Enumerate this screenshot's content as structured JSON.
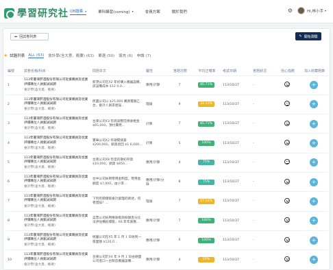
{
  "brand": {
    "name": "學習研究社"
  },
  "nav": {
    "items": [
      {
        "label": "QB題庫",
        "active": true,
        "caret": "▾"
      },
      {
        "label": "單科練習(coming)",
        "active": false,
        "caret": "▾"
      },
      {
        "label": "會員方案",
        "active": false,
        "caret": ""
      },
      {
        "label": "關於我們",
        "active": false,
        "caret": ""
      }
    ]
  },
  "user": {
    "name": "Hi,林小手",
    "caret": "▾"
  },
  "toolbar": {
    "back_label": "回試卷列表",
    "start_label": "開始測驗"
  },
  "filters": {
    "title": "試題列表",
    "tabs": [
      {
        "label": "ALL (63)",
        "active": true
      },
      {
        "label": "會計學(含大意、概要) (63)",
        "active": false
      },
      {
        "label": "單選 (50)",
        "active": false
      },
      {
        "label": "填充 (6)",
        "active": false
      },
      {
        "label": "申論 (7)",
        "active": false
      }
    ]
  },
  "table": {
    "headers": [
      "編號",
      "試卷名稱/科目",
      "問題本文",
      "屬性",
      "答題次數",
      "平均正確率",
      "考試日期",
      "答題狀況",
      "信心指數",
      "加入收藏題庫"
    ],
    "rows": [
      {
        "no": "1",
        "title": "113年臺灣菸酒股份有限公司從業職員及從業評價職位人員甄試試題",
        "subject": "會計學(含大意、概要)",
        "preview": "新港公司在X2 年初購入機器設備，該設備成本 $12 0,0...",
        "attr": "應用/計算",
        "count": "7",
        "rate": "85.71%",
        "rate_color": "#3fb27a",
        "date": "113/10/27",
        "status": "-"
      },
      {
        "no": "2",
        "title": "113年臺灣菸酒股份有限公司從業職員及從業評價職位人員甄試試題",
        "subject": "會計學(含大意、概要)",
        "preview": "民國公司以 $25,000 購買電腦乙台，會計人員李君誤...",
        "attr": "理論",
        "count": "9",
        "rate": "33.33%",
        "rate_color": "#f0b429",
        "date": "113/10/27",
        "status": "-"
      },
      {
        "no": "3",
        "title": "113年臺灣菸酒股份有限公司從業職員及從業評價職位人員甄試試題",
        "subject": "會計學(含大意、概要)",
        "preview": "台東公司X3 年底調整前預收租金 $65,000，預付費用...",
        "attr": "計算",
        "count": "7",
        "rate": "85.71%",
        "rate_color": "#3fb27a",
        "date": "113/10/27",
        "status": "-"
      },
      {
        "no": "4",
        "title": "113年臺灣菸酒股份有限公司從業職員及從業評價職位人員甄試試題",
        "subject": "會計學(含大意、概要)",
        "preview": "寶華公司X2 年期間銷貨 $200,000，銷貨退回 $1 6,000...",
        "attr": "計算",
        "count": "5",
        "rate": "100%",
        "rate_color": "#3fb27a",
        "date": "113/10/27",
        "status": "-"
      },
      {
        "no": "5",
        "title": "113年臺灣菸酒股份有限公司從業職員及從業評價職位人員甄試試題",
        "subject": "會計學(含大意、概要)",
        "preview": "台南公司X8 年度的期初存貨 $10,000，銷貨 $850...",
        "attr": "應用/計算",
        "count": "4",
        "rate": "75%",
        "rate_color": "#45b5a6",
        "date": "113/10/27",
        "status": "-"
      },
      {
        "no": "6",
        "title": "113年臺灣菸酒股份有限公司從業職員及從業評價職位人員甄試試題",
        "subject": "會計學(含大意、概要)",
        "preview": "台中公司採用零用金制度，零用金額度 $7,000，由小李...",
        "attr": "應用/計算/分錄",
        "count": "8",
        "rate": "75%",
        "rate_color": "#45b5a6",
        "date": "113/10/27",
        "status": "-"
      },
      {
        "no": "7",
        "title": "113年臺灣菸酒股份有限公司從業職員及從業評價職位人員甄試試題",
        "subject": "會計學(含大意、概要)",
        "preview": "下列有關壞帳會計處理的敘述，何者錯誤？...",
        "attr": "理論",
        "count": "7",
        "rate": "57.14%",
        "rate_color": "#f0b429",
        "date": "113/10/27",
        "status": "-"
      },
      {
        "no": "8",
        "title": "113年臺灣菸酒股份有限公司從業職員及從業評價職位人員甄試試題",
        "subject": "會計學(含大意、概要)",
        "preview": "菜票公司採用應收帳款餘額百分比法評估備抵壞帳，X6 年年底應...",
        "attr": "應用/計算",
        "count": "7",
        "rate": "100%",
        "rate_color": "#3fb27a",
        "date": "113/10/27",
        "status": "-"
      },
      {
        "no": "9",
        "title": "113年臺灣菸酒股份有限公司從業職員及從業評價職位人員甄試試題",
        "subject": "會計學(含大意、概要)",
        "preview": "桃園公司在X5 年 1 月 1 日收到一張面額 $120,0...",
        "attr": "應用/計算",
        "count": "6",
        "rate": "100%",
        "rate_color": "#3fb27a",
        "date": "113/10/27",
        "status": "-"
      },
      {
        "no": "10",
        "title": "113年臺灣菸酒股份有限公司從業職員及從業評價職位人員甄試試題",
        "subject": "會計學(含大意、概要)",
        "preview": "台東公司於X4 年 9 月 1 日由德國公司進口一台製造機器設備...",
        "attr": "應用/計算",
        "count": "4",
        "rate": "50%",
        "rate_color": "#f0b429",
        "date": "113/10/27",
        "status": "-"
      }
    ]
  },
  "icons": {
    "back": "arrow-left-icon",
    "start": "pencil-icon",
    "settings": "gear-icon",
    "star": "star-icon",
    "confidence": "neutral-face-icon",
    "add": "plus-icon"
  }
}
